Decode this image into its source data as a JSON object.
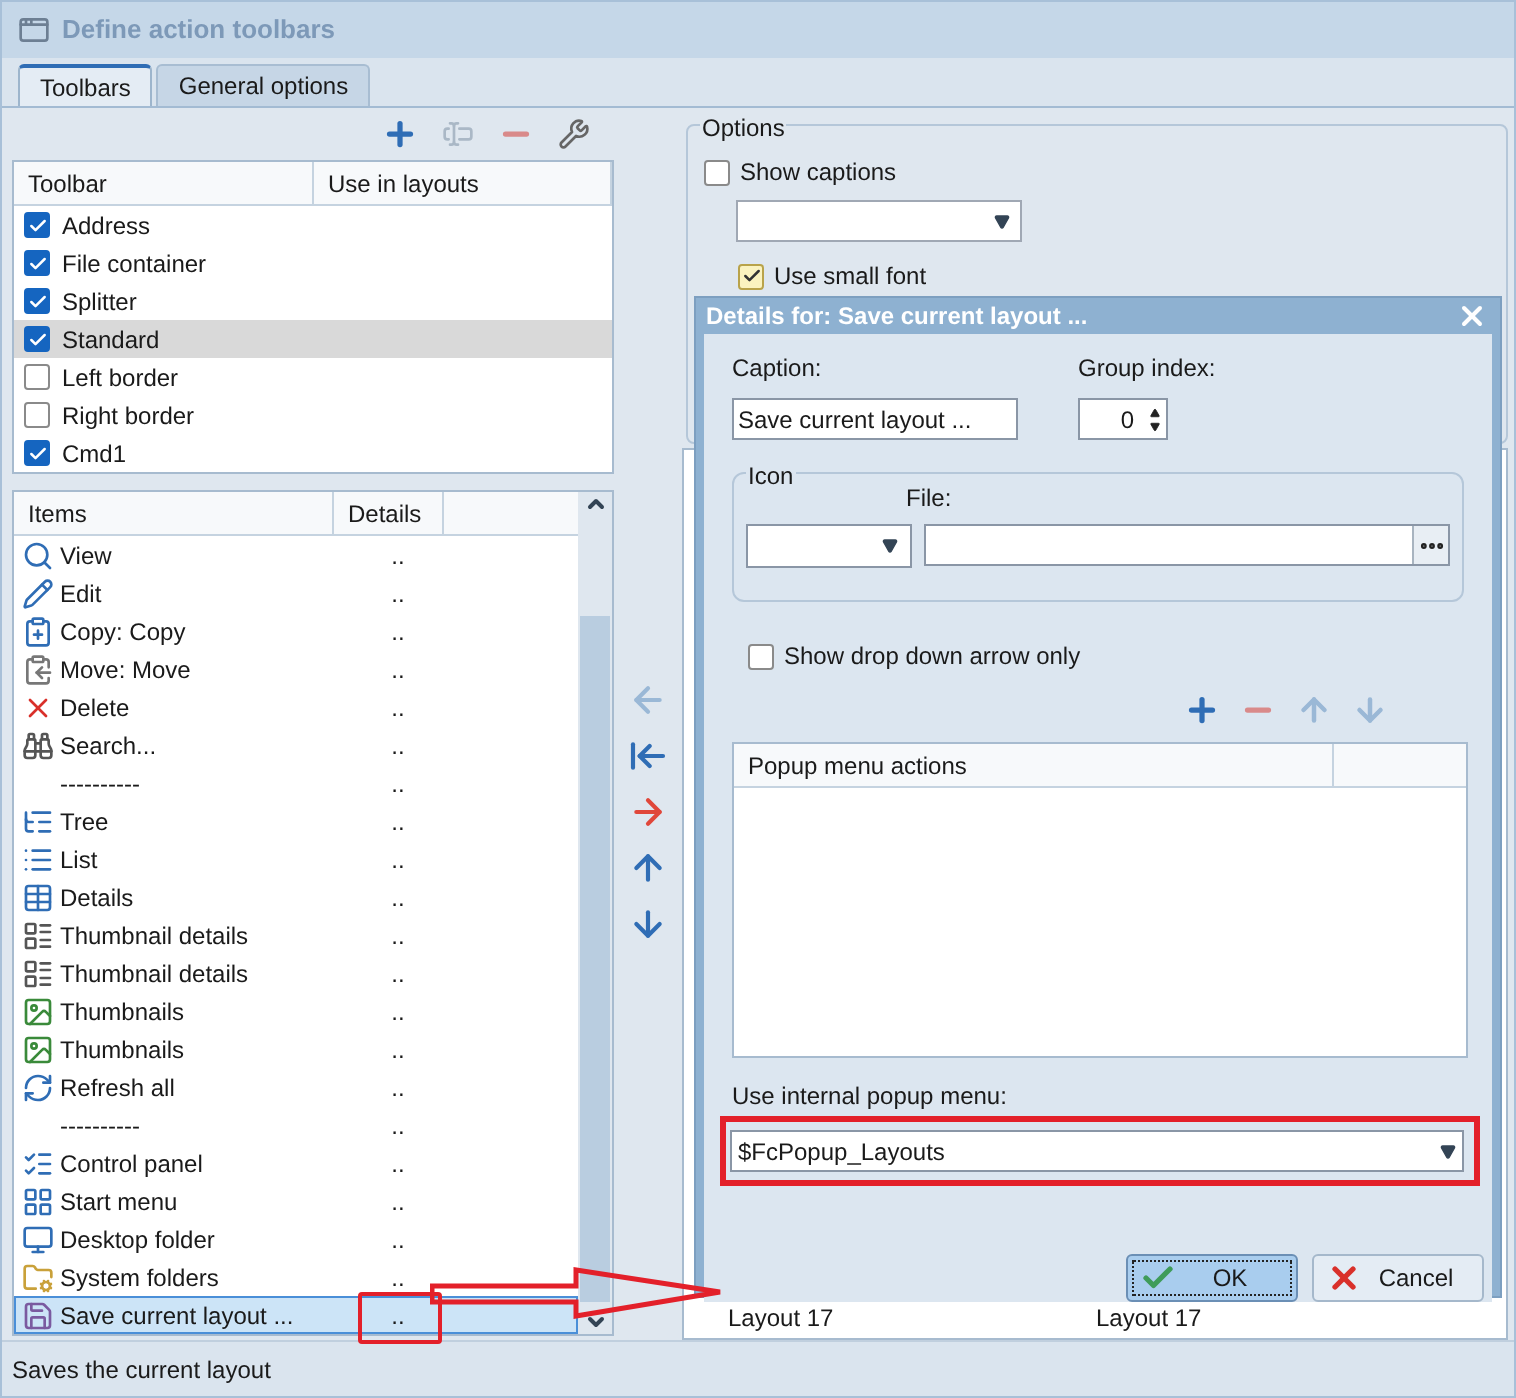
{
  "window": {
    "title": "Define action toolbars"
  },
  "tabs": [
    {
      "label": "Toolbars",
      "selected": true
    },
    {
      "label": "General options",
      "selected": false
    }
  ],
  "toolbars_table": {
    "columns": [
      "Toolbar",
      "Use in layouts"
    ],
    "rows": [
      {
        "name": "Address",
        "checked": true,
        "selected": false
      },
      {
        "name": "File container",
        "checked": true,
        "selected": false
      },
      {
        "name": "Splitter",
        "checked": true,
        "selected": false
      },
      {
        "name": "Standard",
        "checked": true,
        "selected": true
      },
      {
        "name": "Left border",
        "checked": false,
        "selected": false
      },
      {
        "name": "Right border",
        "checked": false,
        "selected": false
      },
      {
        "name": "Cmd1",
        "checked": true,
        "selected": false
      }
    ]
  },
  "items_table": {
    "columns": [
      "Items",
      "Details"
    ],
    "rows": [
      {
        "kind": "action",
        "label": "View",
        "details": "..",
        "selected": false
      },
      {
        "kind": "action",
        "label": "Edit",
        "details": "..",
        "selected": false
      },
      {
        "kind": "action",
        "label": "Copy: Copy",
        "details": "..",
        "selected": false
      },
      {
        "kind": "action",
        "label": "Move: Move",
        "details": "..",
        "selected": false
      },
      {
        "kind": "action",
        "label": "Delete",
        "details": "..",
        "selected": false
      },
      {
        "kind": "action",
        "label": "Search...",
        "details": "..",
        "selected": false
      },
      {
        "kind": "separator",
        "label": "----------",
        "details": "..",
        "selected": false
      },
      {
        "kind": "action",
        "label": "Tree",
        "details": "..",
        "selected": false
      },
      {
        "kind": "action",
        "label": "List",
        "details": "..",
        "selected": false
      },
      {
        "kind": "action",
        "label": "Details",
        "details": "..",
        "selected": false
      },
      {
        "kind": "action",
        "label": "Thumbnail details",
        "details": "..",
        "selected": false
      },
      {
        "kind": "action",
        "label": "Thumbnail details",
        "details": "..",
        "selected": false
      },
      {
        "kind": "action",
        "label": "Thumbnails",
        "details": "..",
        "selected": false
      },
      {
        "kind": "action",
        "label": "Thumbnails",
        "details": "..",
        "selected": false
      },
      {
        "kind": "action",
        "label": "Refresh all",
        "details": "..",
        "selected": false
      },
      {
        "kind": "separator",
        "label": "----------",
        "details": "..",
        "selected": false
      },
      {
        "kind": "action",
        "label": "Control panel",
        "details": "..",
        "selected": false
      },
      {
        "kind": "action",
        "label": "Start menu",
        "details": "..",
        "selected": false
      },
      {
        "kind": "action",
        "label": "Desktop folder",
        "details": "..",
        "selected": false
      },
      {
        "kind": "action",
        "label": "System folders",
        "details": "..",
        "selected": false
      },
      {
        "kind": "action",
        "label": "Save current layout ...",
        "details": "..",
        "selected": true
      }
    ]
  },
  "options": {
    "title": "Options",
    "show_captions": {
      "label": "Show captions",
      "checked": false
    },
    "use_small_font": {
      "label": "Use small font",
      "checked": true
    }
  },
  "layouts_list": {
    "rows": [
      {
        "column_1": "Layout 17",
        "column_2": "Layout 17"
      }
    ]
  },
  "dialog": {
    "title": "Details for: Save current layout ...",
    "caption_label": "Caption:",
    "caption_value": "Save current layout ...",
    "group_index_label": "Group index:",
    "group_index_value": "0",
    "icon_group_title": "Icon",
    "file_label": "File:",
    "show_arrow_only": {
      "label": "Show drop down arrow only",
      "checked": false
    },
    "popup_table": {
      "columns": [
        "Popup menu actions"
      ]
    },
    "internal_popup_label": "Use internal popup menu:",
    "internal_popup_value": "$FcPopup_Layouts",
    "ok": "OK",
    "cancel": "Cancel"
  },
  "status_bar": "Saves the current layout"
}
